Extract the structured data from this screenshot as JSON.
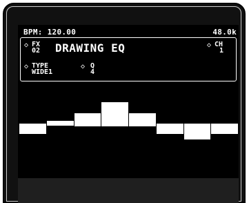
{
  "status": {
    "bpm": "BPM: 120.00",
    "sample_rate": "48.0k"
  },
  "effect": {
    "fx_label": "FX",
    "fx_number": "02",
    "name": "DRAWING EQ",
    "ch_label": "CH",
    "ch_value": "1"
  },
  "params": [
    {
      "label": "TYPE",
      "value": "WIDE1"
    },
    {
      "label": "Q",
      "value": "4"
    }
  ],
  "eq_bands": {
    "count": 8,
    "levels": [
      -1,
      0,
      1,
      3,
      1,
      -1,
      -2,
      -1
    ]
  }
}
